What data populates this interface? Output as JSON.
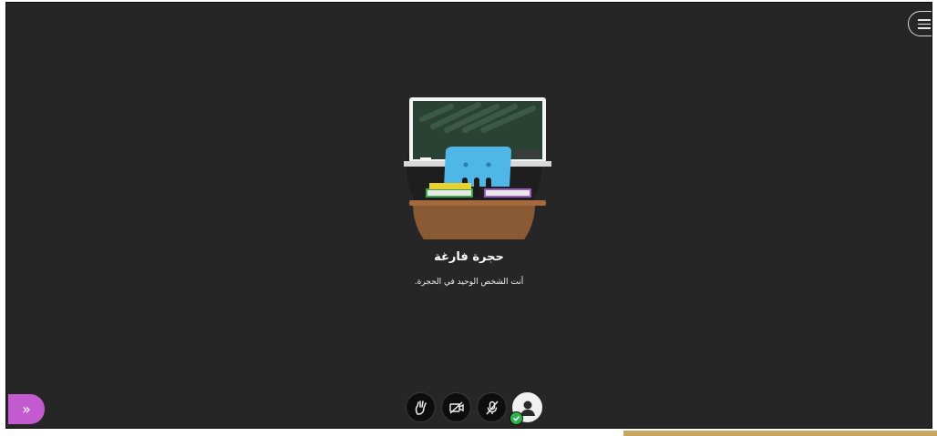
{
  "room": {
    "title": "حجرة فارغة",
    "subtitle": "أنت الشخص الوحيد في الحجرة."
  },
  "controls": [
    {
      "icon": "hand-raise-icon"
    },
    {
      "icon": "video-off-icon"
    },
    {
      "icon": "mic-off-icon"
    },
    {
      "icon": "user-avatar-icon",
      "status": "connected"
    }
  ],
  "colors": {
    "stage_bg": "#262626",
    "expand_button": "#c35ad0",
    "status_green": "#2fb24c",
    "accent_bar": "#c9a664"
  },
  "expand_button": {
    "glyph": "»"
  }
}
